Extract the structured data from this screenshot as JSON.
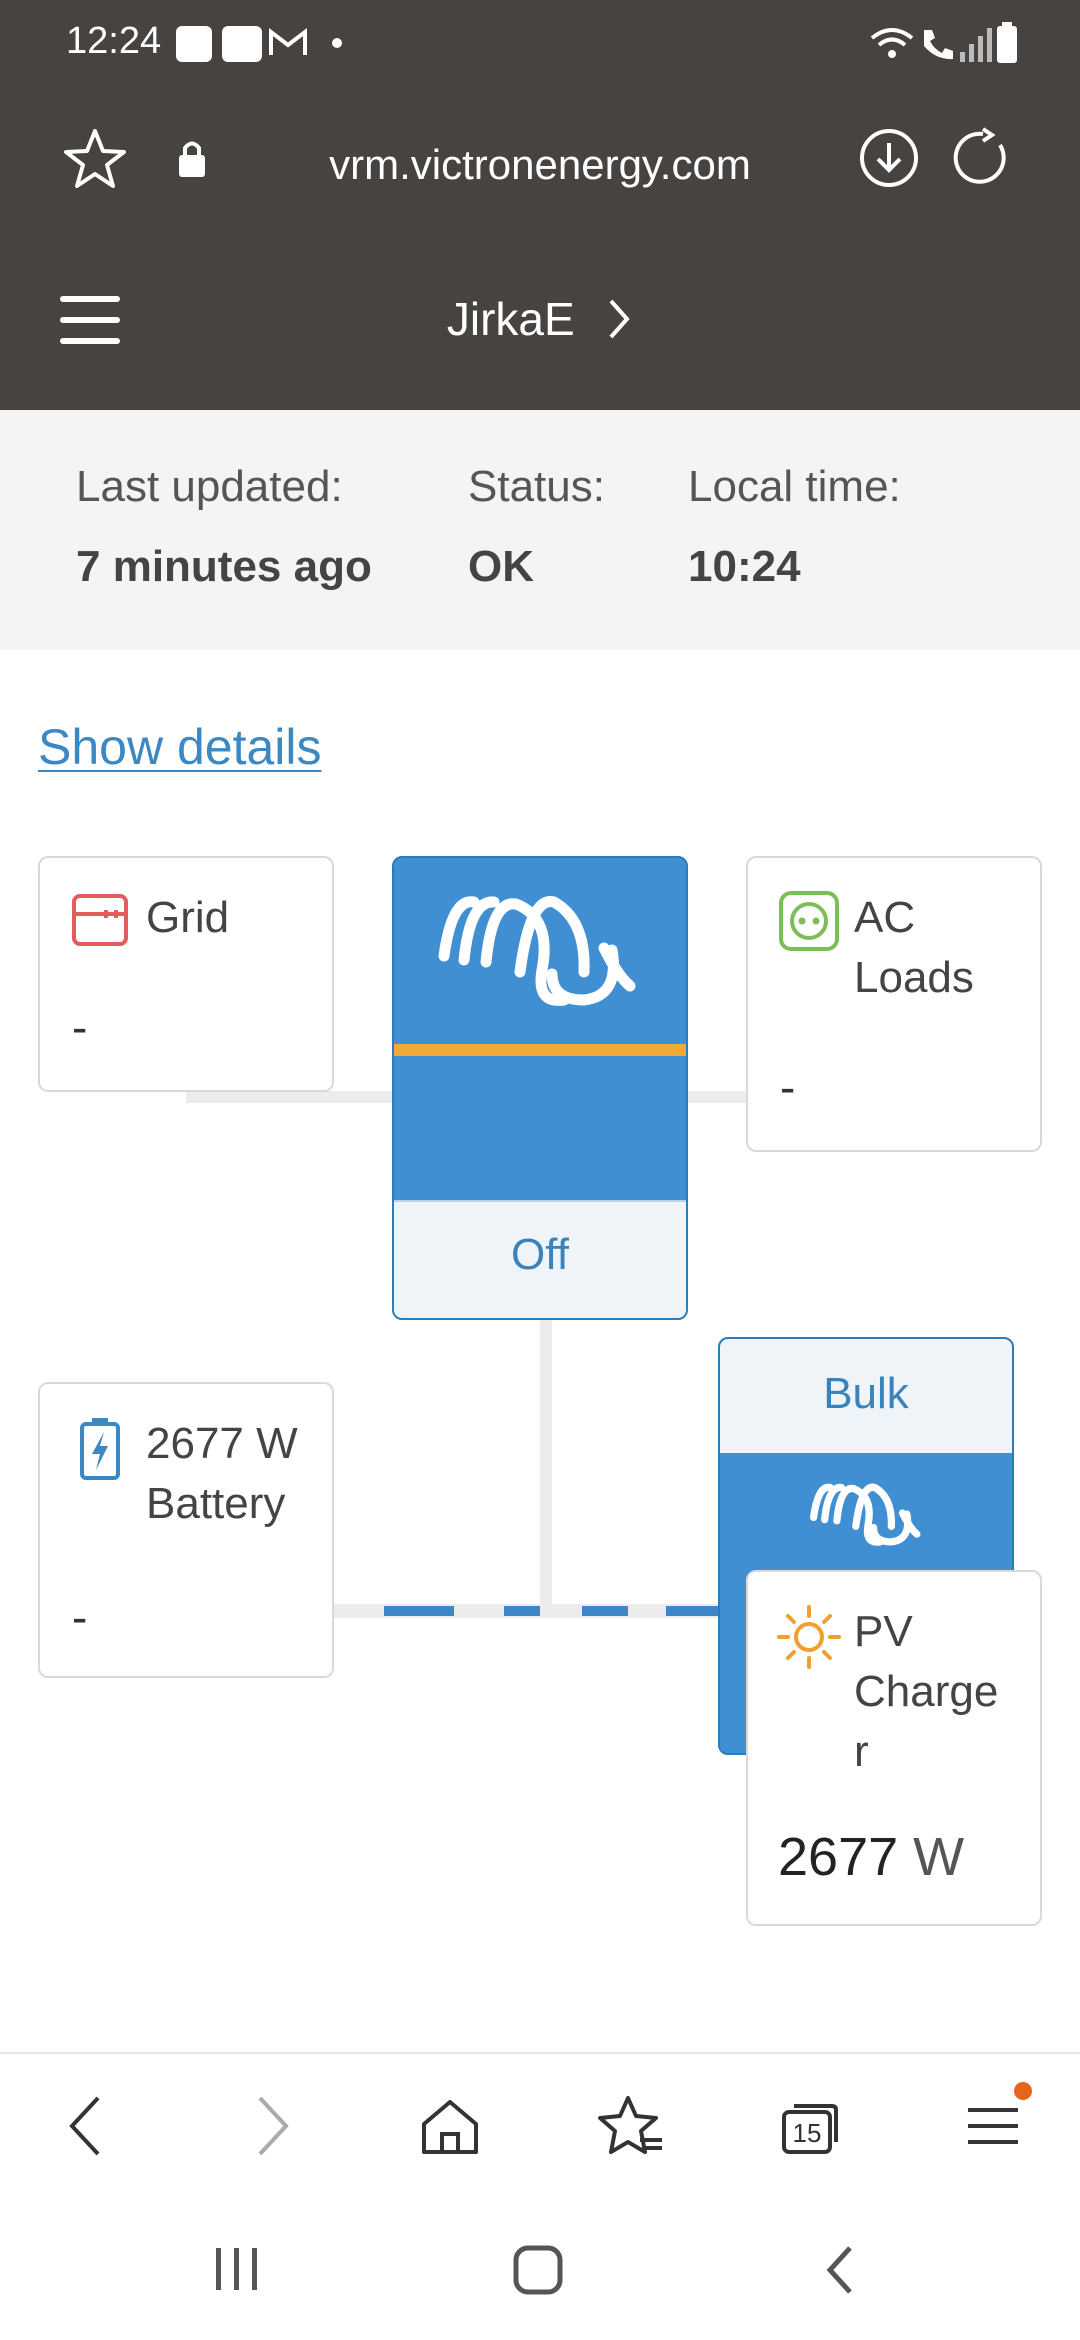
{
  "statusbar": {
    "time": "12:24"
  },
  "browser": {
    "url": "vrm.victronenergy.com",
    "tab_count": "15"
  },
  "site": {
    "title": "JirkaE"
  },
  "info": {
    "last_updated_label": "Last updated:",
    "last_updated_value": "7 minutes ago",
    "status_label": "Status:",
    "status_value": "OK",
    "local_time_label": "Local time:",
    "local_time_value": "10:24"
  },
  "show_details": "Show details",
  "grid": {
    "label": "Grid",
    "value": "-"
  },
  "ac_loads": {
    "label_line1": "AC",
    "label_line2": "Loads",
    "value": "-"
  },
  "inverter": {
    "status": "Off"
  },
  "battery": {
    "power": "2677 W",
    "label": "Battery",
    "value": "-"
  },
  "mppt": {
    "state": "Bulk"
  },
  "pv_charger": {
    "line1": "PV",
    "line2": "Charge",
    "line3": "r",
    "value": "2677",
    "unit": "W"
  },
  "colors": {
    "accent": "#3f8fd2",
    "link": "#3b88c3",
    "orange": "#f2a93a",
    "grid_red": "#e35b5b",
    "loads_green": "#7cbf5a",
    "sun": "#f0a030"
  }
}
